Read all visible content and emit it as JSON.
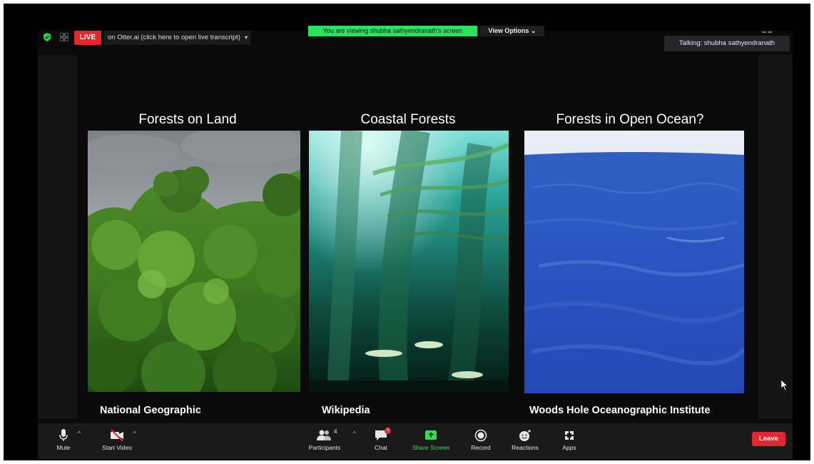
{
  "topbar": {
    "live_label": "LIVE",
    "otter_label": "on Otter.ai (click here to open live transcript)",
    "otter_caret": "▾",
    "viewing_label": "You are viewing shubha sathyendranath's screen",
    "view_options_label": "View Options ⌄",
    "talking_label": "Talking: shubha sathyendranath"
  },
  "slide": {
    "panels": [
      {
        "title": "Forests on Land",
        "caption": "National Geographic"
      },
      {
        "title": "Coastal Forests",
        "caption": "Wikipedia"
      },
      {
        "title": "Forests in Open Ocean?",
        "caption": "Woods Hole Oceanographic Institute"
      }
    ]
  },
  "toolbar": {
    "mute": "Mute",
    "start_video": "Start Video",
    "participants": "Participants",
    "participants_count": "4",
    "chat": "Chat",
    "chat_badge": "3",
    "share_screen": "Share Screen",
    "record": "Record",
    "reactions": "Reactions",
    "apps": "Apps",
    "leave": "Leave",
    "caret": "^"
  },
  "colors": {
    "live_red": "#e0282e",
    "share_green": "#2ee05a",
    "toolbar_bg": "#1a1a1a"
  }
}
